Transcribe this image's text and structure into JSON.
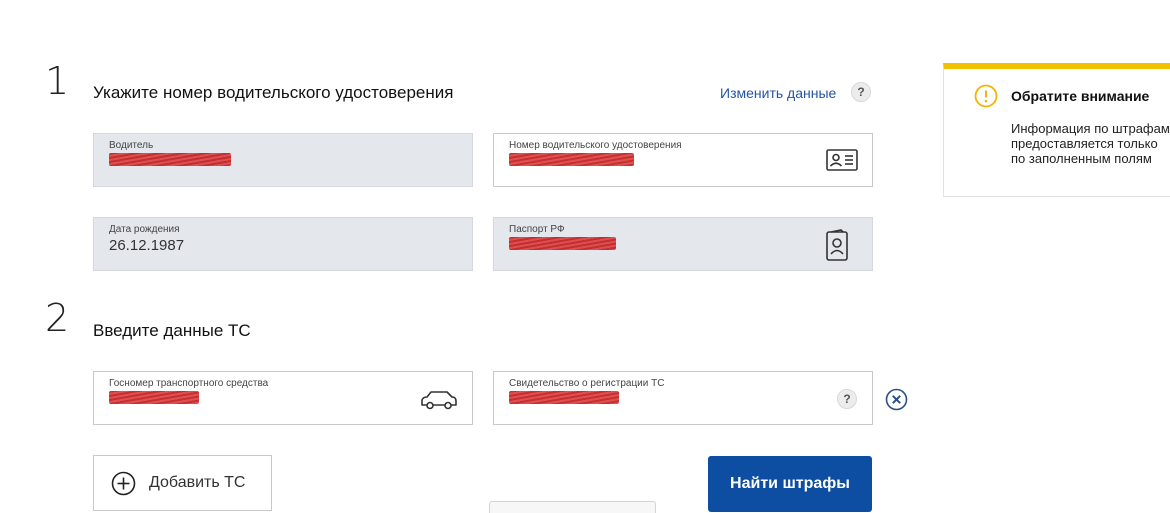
{
  "step1": {
    "number": "1",
    "title": "Укажите номер водительского удостоверения",
    "change_link": "Изменить данные",
    "help": "?",
    "fields": {
      "driver": {
        "label": "Водитель"
      },
      "license": {
        "label": "Номер водительского удостоверения",
        "icon": "id-card-icon"
      },
      "birthdate": {
        "label": "Дата рождения",
        "value": "26.12.1987"
      },
      "passport": {
        "label": "Паспорт РФ",
        "icon": "passport-icon"
      }
    }
  },
  "step2": {
    "number": "2",
    "title": "Введите данные ТС",
    "fields": {
      "plate": {
        "label": "Госномер транспортного средства",
        "icon": "car-icon"
      },
      "registration": {
        "label": "Свидетельство о регистрации ТС",
        "help": "?"
      }
    }
  },
  "actions": {
    "add_vehicle": "Добавить ТС",
    "find_fines": "Найти штрафы"
  },
  "notice": {
    "title": "Обратите внимание",
    "text_line1": "Информация по штрафам",
    "text_line2": "предоставляется только",
    "text_line3": "по заполненным полям",
    "accent_color": "#f2c200",
    "icon": "warning-icon"
  },
  "colors": {
    "primary": "#0e4ea2",
    "link": "#2455a4",
    "redaction": "#c41d1d",
    "disabled_field": "#e4e7ec"
  }
}
